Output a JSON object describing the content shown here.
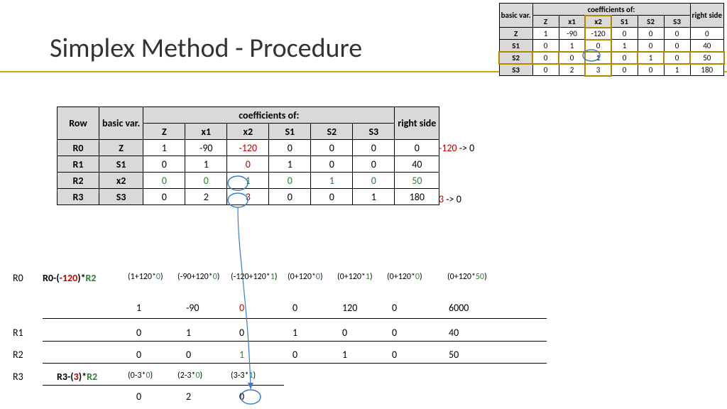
{
  "title": "Simplex Method - Procedure",
  "smallTable": {
    "colHeader": "coefficients of:",
    "cols": [
      "Z",
      "x1",
      "x2",
      "S1",
      "S2",
      "S3"
    ],
    "rightCol": "right side",
    "varCol": "basic var.",
    "rows": [
      {
        "lbl": "Z",
        "c": [
          "1",
          "-90",
          "-120",
          "0",
          "0",
          "0"
        ],
        "r": "0"
      },
      {
        "lbl": "S1",
        "c": [
          "0",
          "1",
          "0",
          "1",
          "0",
          "0"
        ],
        "r": "40"
      },
      {
        "lbl": "S2",
        "c": [
          "0",
          "0",
          "1",
          "0",
          "1",
          "0"
        ],
        "r": "50"
      },
      {
        "lbl": "S3",
        "c": [
          "0",
          "2",
          "3",
          "0",
          "0",
          "1"
        ],
        "r": "180"
      }
    ]
  },
  "mainTable": {
    "rowH": "Row",
    "varH": "basic var.",
    "colHeader": "coefficients of:",
    "cols": [
      "Z",
      "x1",
      "x2",
      "S1",
      "S2",
      "S3"
    ],
    "rightH": "right side",
    "rows": [
      {
        "row": "R0",
        "bv": "Z",
        "c": [
          "1",
          "-90",
          "-120",
          "0",
          "0",
          "0"
        ],
        "r": "0",
        "hi": {
          "2": "red"
        }
      },
      {
        "row": "R1",
        "bv": "S1",
        "c": [
          "0",
          "1",
          "0",
          "1",
          "0",
          "0"
        ],
        "r": "40",
        "hi": {
          "2": "red"
        }
      },
      {
        "row": "R2",
        "bv": "x2",
        "c": [
          "0",
          "0",
          "1",
          "0",
          "1",
          "0"
        ],
        "r": "50",
        "all": "grn"
      },
      {
        "row": "R3",
        "bv": "S3",
        "c": [
          "0",
          "2",
          "3",
          "0",
          "0",
          "1"
        ],
        "r": "180",
        "hi": {
          "2": "red"
        }
      }
    ]
  },
  "notes": {
    "n1a": "-120",
    "n1b": " -> 0",
    "n2a": "3",
    "n2b": " -> 0"
  },
  "comp": {
    "rowLabels": [
      "R0",
      "R1",
      "R2",
      "R3"
    ],
    "f0a": "R0-(",
    "f0b": "-120",
    "f0c": ")*",
    "f0d": "R2",
    "f3a": "R3-(",
    "f3b": "3",
    "f3c": ")*",
    "f3d": "R2",
    "expr0": [
      "(1+120*0)",
      "(-90+120*0)",
      "(-120+120*1)",
      "(0+120*0)",
      "(0+120*1)",
      "(0+120*0)",
      "(0+120*50)"
    ],
    "expr3": [
      "(0-3*0)",
      "(2-3*0)",
      "(3-3*1)"
    ],
    "res": [
      [
        "1",
        "-90",
        "0",
        "0",
        "120",
        "0",
        "6000"
      ],
      [
        "0",
        "1",
        "0",
        "1",
        "0",
        "0",
        "40"
      ],
      [
        "0",
        "0",
        "1",
        "0",
        "1",
        "0",
        "50"
      ],
      [
        "0",
        "2",
        "0"
      ]
    ],
    "hi0": {
      "2": "red"
    },
    "hi2": {
      "2": "grn"
    }
  }
}
